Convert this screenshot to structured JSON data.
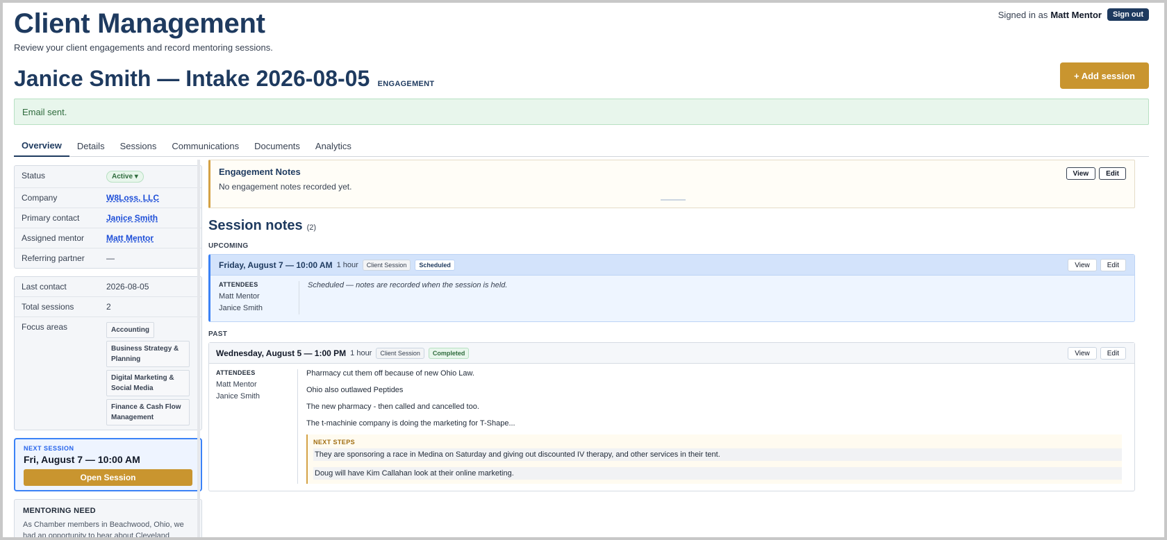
{
  "header": {
    "app_title": "Client Management",
    "app_subtitle": "Review your client engagements and record mentoring sessions.",
    "signed_in_prefix": "Signed in as",
    "signed_in_user": "Matt Mentor",
    "sign_out_label": "Sign out"
  },
  "engagement": {
    "title": "Janice Smith — Intake 2026-08-05",
    "badge": "ENGAGEMENT",
    "add_session_label": "+ Add session"
  },
  "alert": {
    "message": "Email sent."
  },
  "tabs": [
    {
      "label": "Overview",
      "active": true
    },
    {
      "label": "Details"
    },
    {
      "label": "Sessions"
    },
    {
      "label": "Communications"
    },
    {
      "label": "Documents"
    },
    {
      "label": "Analytics"
    }
  ],
  "sidebar": {
    "info": [
      {
        "key": "Status",
        "value": "Active ▾"
      },
      {
        "key": "Company",
        "value": "W8Loss, LLC"
      },
      {
        "key": "Primary contact",
        "value": "Janice Smith"
      },
      {
        "key": "Assigned mentor",
        "value": "Matt Mentor"
      },
      {
        "key": "Referring partner",
        "value": "—"
      }
    ],
    "stats": {
      "last_contact_label": "Last contact",
      "last_contact": "2026-08-05",
      "total_sessions_label": "Total sessions",
      "total_sessions": "2",
      "focus_areas_label": "Focus areas",
      "focus_areas": [
        "Accounting",
        "Business Strategy & Planning",
        "Digital Marketing & Social Media",
        "Finance & Cash Flow Management"
      ]
    },
    "next_session": {
      "label": "NEXT SESSION",
      "time": "Fri, August 7 — 10:00 AM",
      "open_label": "Open Session"
    },
    "mentoring_need": {
      "title": "MENTORING NEED",
      "text": "As Chamber members in Beachwood, Ohio, we had an opportunity to hear about Cleveland"
    }
  },
  "engagement_notes": {
    "title": "Engagement Notes",
    "text": "No engagement notes recorded yet.",
    "view_label": "View",
    "edit_label": "Edit"
  },
  "sessions": {
    "title": "Session notes",
    "count": "(2)",
    "upcoming_label": "UPCOMING",
    "past_label": "PAST",
    "attendees_label": "ATTENDEES",
    "view_label": "View",
    "edit_label": "Edit",
    "upcoming": {
      "when": "Friday, August 7 — 10:00 AM",
      "duration": "1 hour",
      "type": "Client Session",
      "status": "Scheduled",
      "attendees": [
        "Matt Mentor",
        "Janice Smith"
      ],
      "note": "Scheduled — notes are recorded when the session is held."
    },
    "past": {
      "when": "Wednesday, August 5 — 1:00 PM",
      "duration": "1 hour",
      "type": "Client Session",
      "status": "Completed",
      "attendees": [
        "Matt Mentor",
        "Janice Smith"
      ],
      "notes": [
        "Pharmacy cut them off because of new Ohio Law.",
        "Ohio also outlawed Peptides",
        "The new pharmacy - then called and cancelled too.",
        "The t-machinie company is doing the marketing for T-Shape..."
      ],
      "next_steps_label": "NEXT STEPS",
      "next_steps": [
        "They are sponsoring a race in Medina on Saturday and giving out discounted IV therapy, and other services in their tent.",
        "Doug will have Kim Callahan look at their online marketing."
      ]
    }
  }
}
